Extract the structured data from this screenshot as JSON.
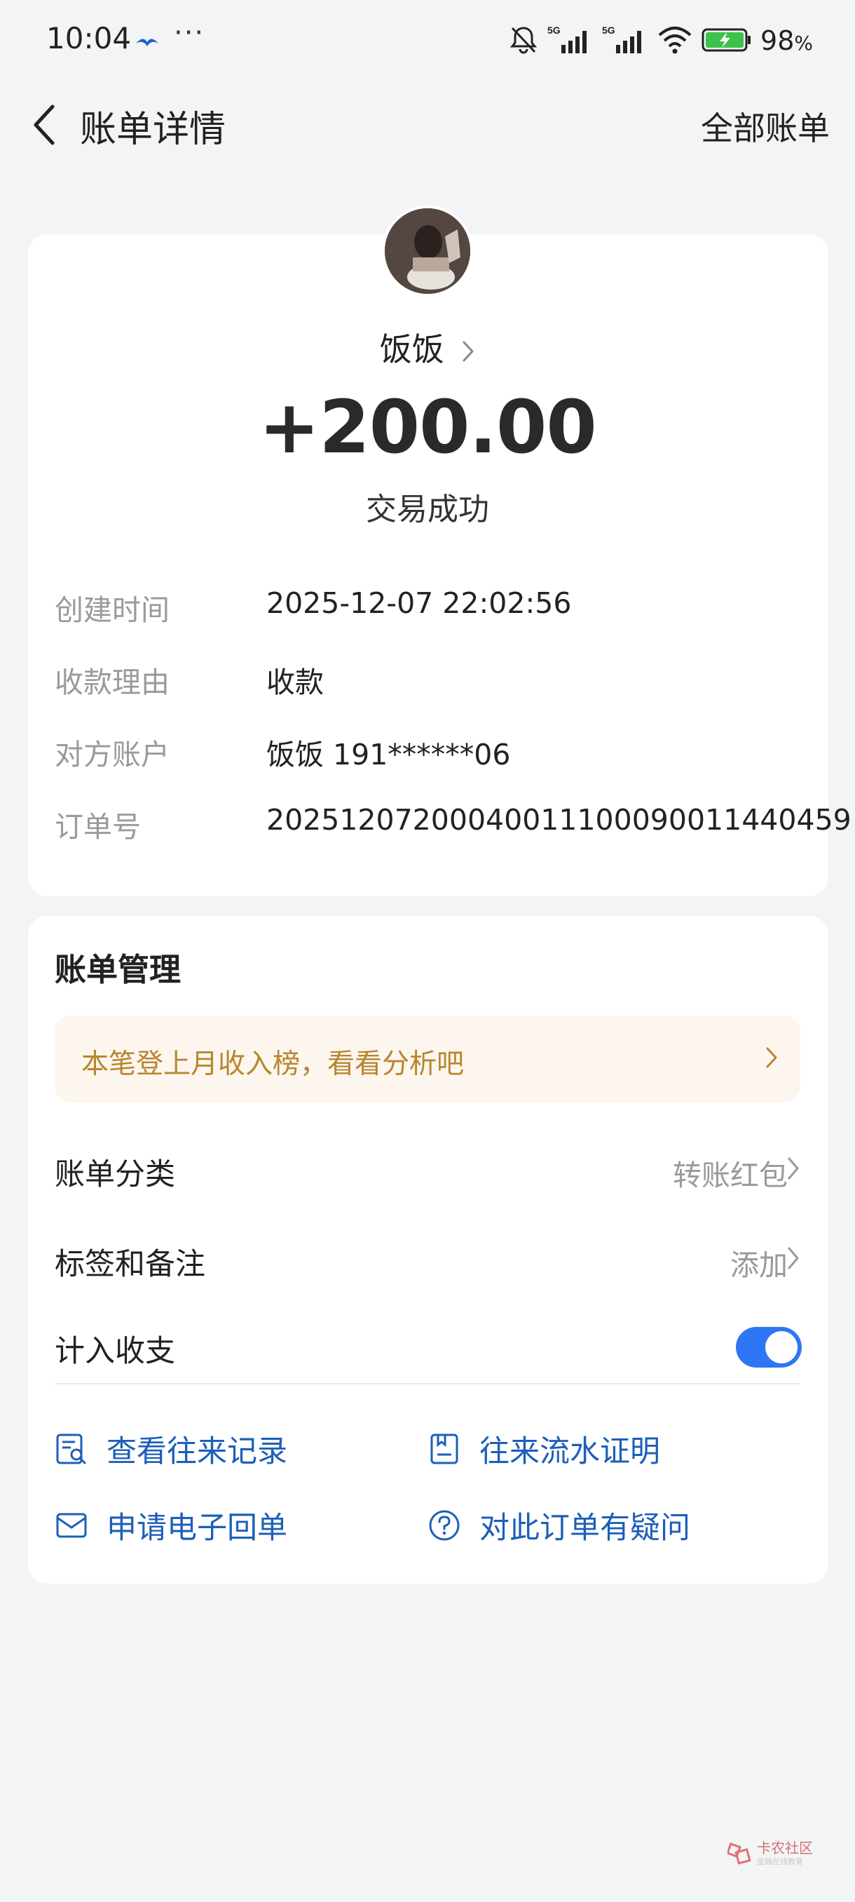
{
  "status_bar": {
    "time": "10:04",
    "dots": "···",
    "battery_percent": "98",
    "battery_suffix": "%",
    "signal_labels": [
      "5G",
      "5G"
    ],
    "icons": [
      "bell-muted-icon",
      "signal-icon",
      "signal-icon",
      "wifi-icon",
      "battery-charging-icon"
    ]
  },
  "header": {
    "title": "账单详情",
    "right_action": "全部账单"
  },
  "summary": {
    "payer_name": "饭饭",
    "amount": "+200.00",
    "status": "交易成功"
  },
  "details": [
    {
      "label": "创建时间",
      "value": "2025-12-07 22:02:56"
    },
    {
      "label": "收款理由",
      "value": "收款"
    },
    {
      "label": "对方账户",
      "value": "饭饭 191******06"
    },
    {
      "label": "订单号",
      "value": "20251207200040011100090011440459"
    }
  ],
  "management": {
    "title": "账单管理",
    "banner_text": "本笔登上月收入榜，看看分析吧",
    "category_label": "账单分类",
    "category_value": "转账红包",
    "tags_label": "标签和备注",
    "tags_value": "添加",
    "include_label": "计入收支",
    "include_enabled": true
  },
  "actions": [
    {
      "label": "查看往来记录",
      "icon": "record-search-icon"
    },
    {
      "label": "往来流水证明",
      "icon": "document-icon"
    },
    {
      "label": "申请电子回单",
      "icon": "envelope-icon"
    },
    {
      "label": "对此订单有疑问",
      "icon": "question-icon"
    }
  ],
  "watermark": {
    "text": "卡农社区",
    "sub": "金融在线教育"
  },
  "colors": {
    "background": "#f3f4f6",
    "accent_blue": "#2f76f4",
    "link_blue": "#1d5fb8",
    "banner_bg": "#fcf6ee",
    "banner_text": "#b8862f"
  }
}
